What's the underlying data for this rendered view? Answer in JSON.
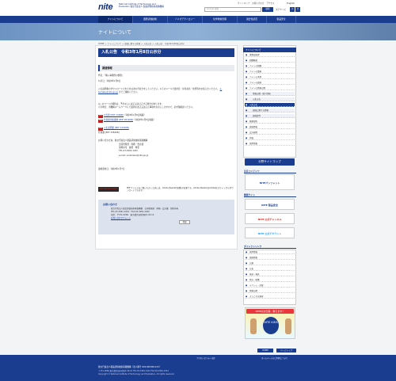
{
  "header": {
    "logo": "nite",
    "logo_sub": "National Institute of Technology and Evaluation 独立行政法人 製品評価技術基盤機構",
    "util_links": "サイトマップ　お問い合わせ　アクセス",
    "search_placeholder": "Google 検索",
    "search_button": "検索",
    "size_label": "文字サイズ",
    "size_small": "小",
    "size_large": "大",
    "lang": "English"
  },
  "nav": [
    "ナイトについて",
    "国際評価技術",
    "バイオテクノロジー",
    "化学物質管理",
    "適合性認定",
    "製品安全"
  ],
  "banner_title": "ナイトについて",
  "breadcrumb": "HOME ＞ ナイトについて ＞ 調達に関する情報 ＞ 入札公告 ＞ 入札公告　令和3年1月8日公示分",
  "page_title": "入札公告　令和3年1月8日公示分",
  "subtitle": "調達情報",
  "body": {
    "p1": "件名：「購入事務所の整理」",
    "p2": "公示日：令和3年1月8日",
    "p3": "入札説明書のダウンロードされた方は次の手続きをしてください。以下のメールで会社名・担当者名・住所等をお知らせください。",
    "p3_email": "e-kemaku@nite.go.jp",
    "p3_tail": "までご連絡ください。",
    "p4": "※このページの資料は、予告なしに改正又は訂正する場合があります。",
    "p5": "その場合、当機構ホームページにて最新の改正又は訂正事項をお示ししますので、必ず御確認ください。",
    "pdf_label": "PDF",
    "doc1_link": "公告状 [PDF 130KB]",
    "doc1_note": "（令和3年1月8日掲載）",
    "doc2_link": "仕様書付属書類 [PDF 2614KB]",
    "doc2_note": "（令和3年1月8日掲載）",
    "doc3_link": "入札説明書 [PDF 2334KB]",
    "doc4": "仕様書 [PDF 2584KB]",
    "contact_head": "お問い合わせ先：独立行政法人製品評価技術基盤機構",
    "contact_lines": [
      "企画管理部　財務・会計課",
      "契約担当　藤原　隆史",
      "TEL:03-3481-1932",
      "e-mail: e-kemaku@nite.go.jp"
    ],
    "updated": "最終更新日：令和3年1月7日"
  },
  "adobe": {
    "badge": "Get Adobe Reader",
    "text": "PDFファイルをご覧いただくためには、Adobe Reader(無償)が必要です。Adobe ReaderはAdobe社のサイトからダウンロードできます。"
  },
  "contact_box": {
    "head": "お問い合わせ",
    "org": "独立行政法人製品評価技術基盤機構　企画管理部　財務・会計課　契約担当",
    "tel": "TEL:03-3481-1932　FAX:03-3481-2940",
    "address": "住所：〒151-0066　東京都渋谷区西原2-49-10",
    "map": "地図",
    "form": "お問い合わせフォーム"
  },
  "sidebar": {
    "title": "ナイトについて",
    "items": [
      "理事長挨拶",
      "組織概要",
      "ナイトの組織",
      "ナイトの業務",
      "ナイトの予算",
      "ナイトの調達",
      "ナイトの情報公開",
      "情報公開・個人情報",
      "入札公告",
      "入札公告",
      "調達に関する情報",
      "調達案件",
      "随意契約",
      "調達情報",
      "会計規程",
      "評価",
      "採用情報"
    ],
    "sitemap_btn": "分野サイトマップ"
  },
  "recommend": {
    "head": "注目コンテンツ",
    "pamphlet": "NITEパンフレット"
  },
  "related": {
    "head": "関連サイト",
    "site1": "NITE 製品安全",
    "youtube": "NITE 公式チャンネル",
    "twitter": "NITE 公式アカウント"
  },
  "directory": {
    "head": "ダイレクトリンク",
    "items": [
      "採用情報",
      "調達情報",
      "公募",
      "公表",
      "報道・発表",
      "所在・組織",
      "イベント・記録",
      "情報公開",
      "ようこそ広報室"
    ]
  },
  "kids": {
    "title": "NITEのお仕事、教えます！",
    "logo": "NITE KIDS"
  },
  "bottom": {
    "home": "HOME",
    "top": "ページトップ",
    "link1": "アクセシビリティ方針",
    "link2": "ホームページのご利用について"
  },
  "footer": {
    "line1": "独立行政法人製品評価技術基盤機構（法人番号 9011005001123）",
    "line2": "〒151-0066 東京都渋谷区西原2-49-10 TEL:03-3481-1921 FAX:03-3481-1934",
    "line3": "Copyright © National Institute of Technology and Evaluation, All rights reserved."
  }
}
